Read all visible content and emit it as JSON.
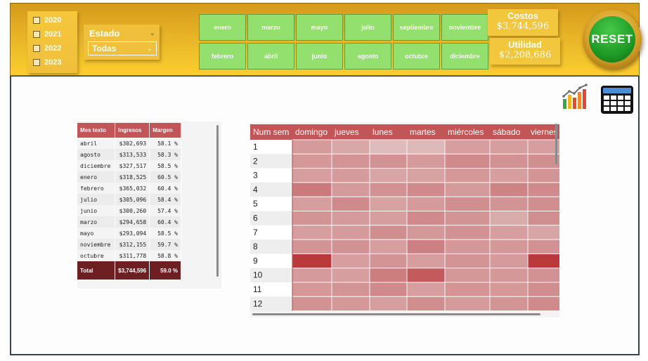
{
  "colors": {
    "header_gold": "#e7b327",
    "month_green": "#93e06e",
    "table_header": "#c25558",
    "total_row": "#6e1f22",
    "reset_green": "#1f9a25"
  },
  "years": [
    "2020",
    "2021",
    "2022",
    "2023"
  ],
  "estado": {
    "title": "Estado",
    "value": "Todas"
  },
  "months": [
    "enero",
    "marzo",
    "mayo",
    "julio",
    "septiembre",
    "noviembre",
    "febrero",
    "abril",
    "junio",
    "agosto",
    "octubre",
    "diciembre"
  ],
  "kpis": {
    "costos": {
      "title": "Costos",
      "value": "$3,744,596"
    },
    "utilidad": {
      "title": "Utilidad",
      "value": "$2,208,686"
    }
  },
  "reset_label": "RESET",
  "icons": {
    "chart": "bar-chart-icon",
    "calc": "calculator-icon"
  },
  "summary": {
    "columns": [
      "Mes texto",
      "Ingresos",
      "Margen"
    ],
    "rows": [
      [
        "abril",
        "$302,693",
        "58.1 %"
      ],
      [
        "agosto",
        "$313,533",
        "58.3 %"
      ],
      [
        "diciembre",
        "$327,517",
        "58.5 %"
      ],
      [
        "enero",
        "$318,525",
        "60.5 %"
      ],
      [
        "febrero",
        "$365,032",
        "60.4 %"
      ],
      [
        "julio",
        "$305,096",
        "58.4 %"
      ],
      [
        "junio",
        "$300,260",
        "57.4 %"
      ],
      [
        "marzo",
        "$294,658",
        "60.4 %"
      ],
      [
        "mayo",
        "$293,094",
        "58.5 %"
      ],
      [
        "noviembre",
        "$312,155",
        "59.7 %"
      ],
      [
        "octubre",
        "$311,778",
        "58.8 %"
      ]
    ],
    "total": [
      "Total",
      "$3,744,596",
      "59.0 %"
    ]
  },
  "heatmap": {
    "columns": [
      "Num sem",
      "domingo",
      "jueves",
      "lunes",
      "martes",
      "miércoles",
      "sábado",
      "viernes"
    ],
    "weeks": [
      "1",
      "2",
      "3",
      "4",
      "5",
      "6",
      "7",
      "8",
      "9",
      "10",
      "11",
      "12"
    ],
    "intensity": [
      [
        0.42,
        0.34,
        0.22,
        0.24,
        0.4,
        0.4,
        0.4
      ],
      [
        0.44,
        0.46,
        0.48,
        0.42,
        0.52,
        0.48,
        0.5
      ],
      [
        0.4,
        0.42,
        0.36,
        0.38,
        0.44,
        0.4,
        0.46
      ],
      [
        0.62,
        0.42,
        0.48,
        0.52,
        0.42,
        0.56,
        0.52
      ],
      [
        0.4,
        0.52,
        0.38,
        0.42,
        0.5,
        0.46,
        0.5
      ],
      [
        0.46,
        0.42,
        0.4,
        0.52,
        0.46,
        0.32,
        0.5
      ],
      [
        0.4,
        0.42,
        0.5,
        0.44,
        0.48,
        0.4,
        0.36
      ],
      [
        0.46,
        0.48,
        0.4,
        0.58,
        0.44,
        0.44,
        0.48
      ],
      [
        1.0,
        0.4,
        0.46,
        0.4,
        0.46,
        0.42,
        1.0
      ],
      [
        0.42,
        0.4,
        0.6,
        0.8,
        0.44,
        0.44,
        0.48
      ],
      [
        0.44,
        0.46,
        0.52,
        0.4,
        0.46,
        0.44,
        0.5
      ],
      [
        0.48,
        0.44,
        0.4,
        0.5,
        0.42,
        0.46,
        0.52
      ]
    ]
  }
}
